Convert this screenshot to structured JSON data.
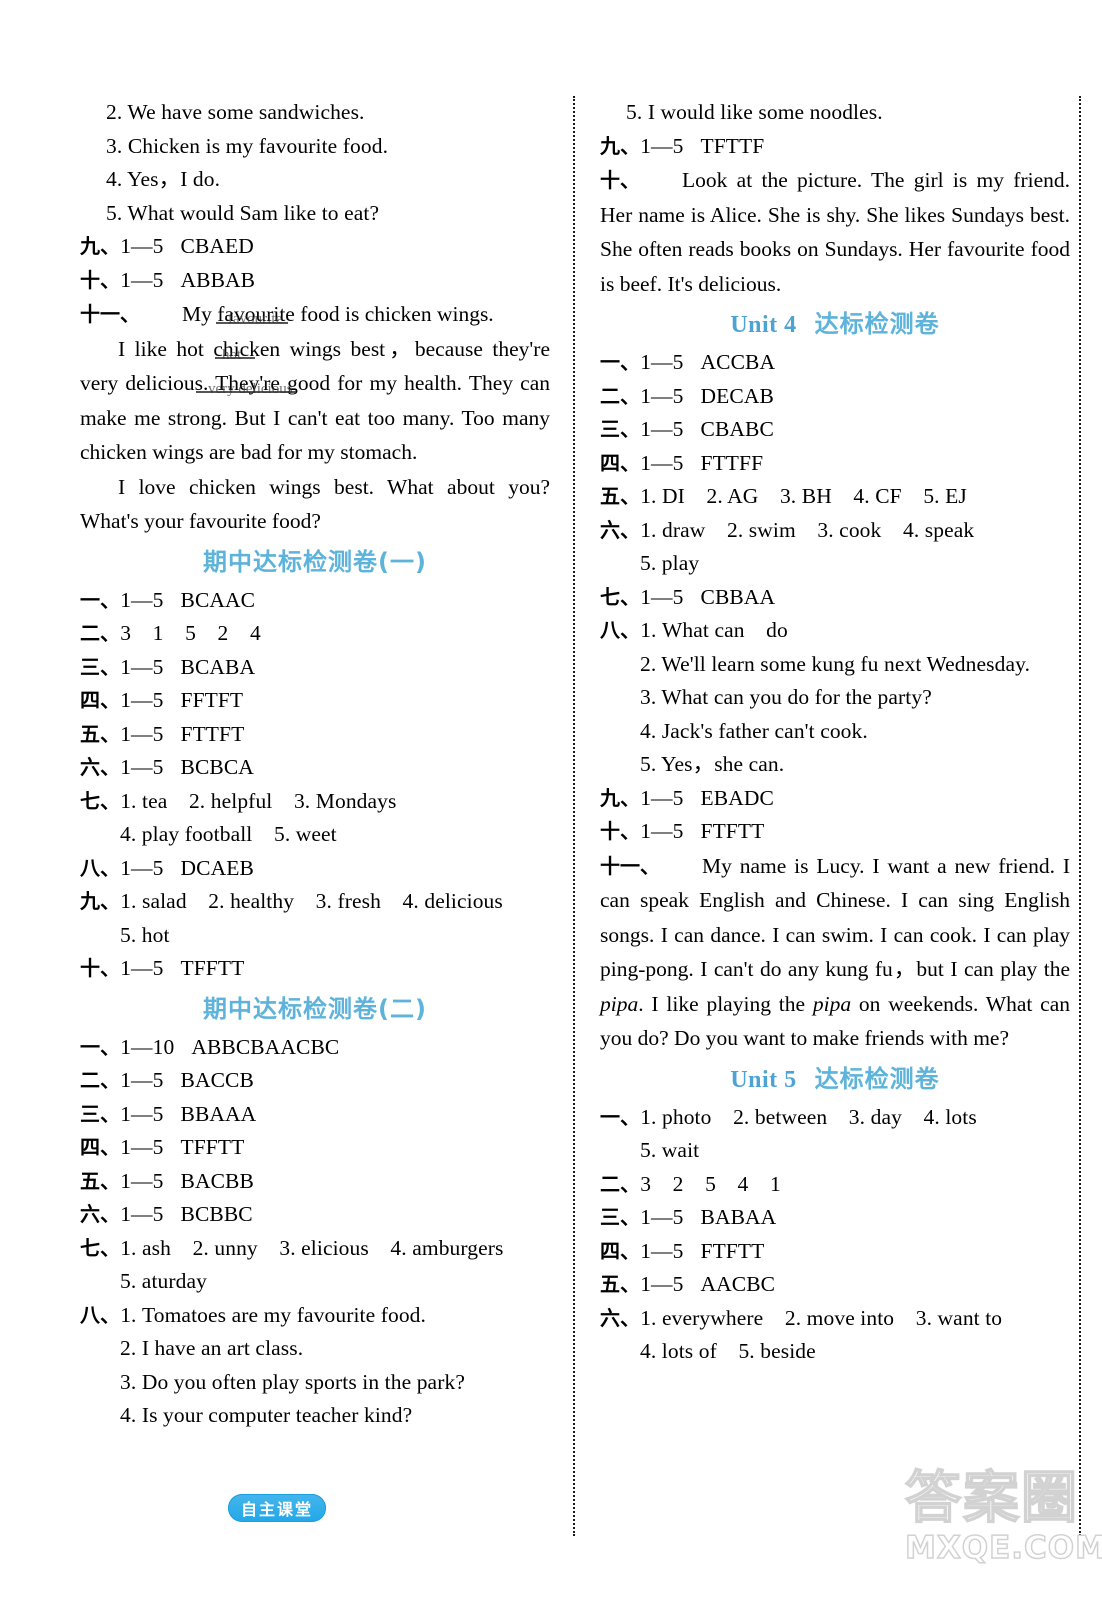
{
  "page": {
    "badge_label": "自主课堂",
    "watermark_cjk": "答案圈",
    "watermark_url": "MXQE.COM",
    "accent_blue": "#5eb3da",
    "badge_blue": "#22a7e8"
  },
  "left_column": {
    "top_answers": [
      {
        "num": "2.",
        "text": "We have some sandwiches."
      },
      {
        "num": "3.",
        "text": "Chicken is my favourite food."
      },
      {
        "num": "4.",
        "text": "Yes，I do."
      },
      {
        "num": "5.",
        "text": "What would Sam like to eat?"
      }
    ],
    "rows_before_essay": [
      {
        "ord": "九、",
        "range": "1—5",
        "answer": "CBAED"
      },
      {
        "ord": "十、",
        "range": "1—5",
        "answer": "ABBAB"
      }
    ],
    "essay": {
      "ord": "十一、",
      "p1": "My favourite food is chicken wings.",
      "p2_a": "I like hot chicken wings best，because they're very delicious. They're good for my health. They can make me strong. But I can't eat too many. Too many chicken wings are bad for my stomach.",
      "p2_b": "I love chicken wings best. What about you? What's your favourite food?",
      "smudge1": "favourite",
      "smudge2": "hot",
      "smudge3": "very delicious"
    },
    "midterm1": {
      "heading": "期中达标检测卷(一)",
      "rows": [
        {
          "ord": "一、",
          "range": "1—5",
          "answer": "BCAAC"
        },
        {
          "ord": "二、",
          "range": "",
          "answer": "3　1　5　2　4"
        },
        {
          "ord": "三、",
          "range": "1—5",
          "answer": "BCABA"
        },
        {
          "ord": "四、",
          "range": "1—5",
          "answer": "FFTFT"
        },
        {
          "ord": "五、",
          "range": "1—5",
          "answer": "FTTFT"
        },
        {
          "ord": "六、",
          "range": "1—5",
          "answer": "BCBCA"
        }
      ],
      "q7": {
        "ord": "七、",
        "line1": "1. tea　2. helpful　3. Mondays",
        "line2": "4. play football　5. weet"
      },
      "q8": {
        "ord": "八、",
        "range": "1—5",
        "answer": "DCAEB"
      },
      "q9": {
        "ord": "九、",
        "line1": "1. salad　2. healthy　3. fresh　4. delicious",
        "line2": "5. hot"
      },
      "q10": {
        "ord": "十、",
        "range": "1—5",
        "answer": "TFFTT"
      }
    },
    "midterm2": {
      "heading": "期中达标检测卷(二)",
      "rows": [
        {
          "ord": "一、",
          "range": "1—10",
          "answer": "ABBCBAACBC"
        },
        {
          "ord": "二、",
          "range": "1—5",
          "answer": "BACCB"
        },
        {
          "ord": "三、",
          "range": "1—5",
          "answer": "BBAAA"
        },
        {
          "ord": "四、",
          "range": "1—5",
          "answer": "TFFTT"
        },
        {
          "ord": "五、",
          "range": "1—5",
          "answer": "BACBB"
        },
        {
          "ord": "六、",
          "range": "1—5",
          "answer": "BCBBC"
        }
      ],
      "q7": {
        "ord": "七、",
        "line1": "1. ash　2. unny　3. elicious　4. amburgers",
        "line2": "5. aturday"
      },
      "q8": {
        "ord": "八、",
        "items": [
          {
            "num": "1.",
            "text": "Tomatoes are my favourite food."
          },
          {
            "num": "2.",
            "text": "I have an art class."
          },
          {
            "num": "3.",
            "text": "Do you often play sports in the park?"
          },
          {
            "num": "4.",
            "text": "Is your computer teacher kind?"
          }
        ]
      }
    }
  },
  "right_column": {
    "top_item": {
      "num": "5.",
      "text": "I would like some noodles."
    },
    "q9": {
      "ord": "九、",
      "range": "1—5",
      "answer": "TFTTF"
    },
    "q10_essay": {
      "ord": "十、",
      "text": "Look at the picture. The girl is my friend. Her name is Alice. She is shy. She likes Sundays best. She often reads books on Sundays. Her favourite food is beef. It's delicious."
    },
    "unit4": {
      "heading_unit": "Unit 4",
      "heading_cjk": "达标检测卷",
      "rows": [
        {
          "ord": "一、",
          "range": "1—5",
          "answer": "ACCBA"
        },
        {
          "ord": "二、",
          "range": "1—5",
          "answer": "DECAB"
        },
        {
          "ord": "三、",
          "range": "1—5",
          "answer": "CBABC"
        },
        {
          "ord": "四、",
          "range": "1—5",
          "answer": "FTTFF"
        }
      ],
      "q5": {
        "ord": "五、",
        "line1": "1. DI　2. AG　3. BH　4. CF　5. EJ"
      },
      "q6": {
        "ord": "六、",
        "line1": "1. draw　2. swim　3. cook　4. speak",
        "line2": "5. play"
      },
      "q7": {
        "ord": "七、",
        "range": "1—5",
        "answer": "CBBAA"
      },
      "q8": {
        "ord": "八、",
        "items": [
          {
            "num": "1.",
            "text": "What can　do"
          },
          {
            "num": "2.",
            "text": "We'll learn some kung fu next Wednesday."
          },
          {
            "num": "3.",
            "text": "What can you do for the party?"
          },
          {
            "num": "4.",
            "text": "Jack's father can't cook."
          },
          {
            "num": "5.",
            "text": "Yes，she can."
          }
        ]
      },
      "q9": {
        "ord": "九、",
        "range": "1—5",
        "answer": "EBADC"
      },
      "q10": {
        "ord": "十、",
        "range": "1—5",
        "answer": "FTFTT"
      },
      "q11": {
        "ord": "十一、",
        "text_a": "My name is Lucy. I want a new friend. I can speak English and Chinese. I can sing English songs. I can dance. I can swim. I can cook. I can play ping-pong. I can't do any kung fu，but I can play the ",
        "italic_1": "pipa",
        "text_b": ". I like playing the ",
        "italic_2": "pipa",
        "text_c": " on weekends. What can you do? Do you want to make friends with me?"
      }
    },
    "unit5": {
      "heading_unit": "Unit 5",
      "heading_cjk": "达标检测卷",
      "q1": {
        "ord": "一、",
        "line1": "1. photo　2. between　3. day　4. lots",
        "line2": "5. wait"
      },
      "q2": {
        "ord": "二、",
        "answer": "3　2　5　4　1"
      },
      "rows": [
        {
          "ord": "三、",
          "range": "1—5",
          "answer": "BABAA"
        },
        {
          "ord": "四、",
          "range": "1—5",
          "answer": "FTFTT"
        },
        {
          "ord": "五、",
          "range": "1—5",
          "answer": "AACBC"
        }
      ],
      "q6": {
        "ord": "六、",
        "line1": "1. everywhere　2. move into　3. want to",
        "line2": "4. lots of　5. beside"
      }
    }
  }
}
